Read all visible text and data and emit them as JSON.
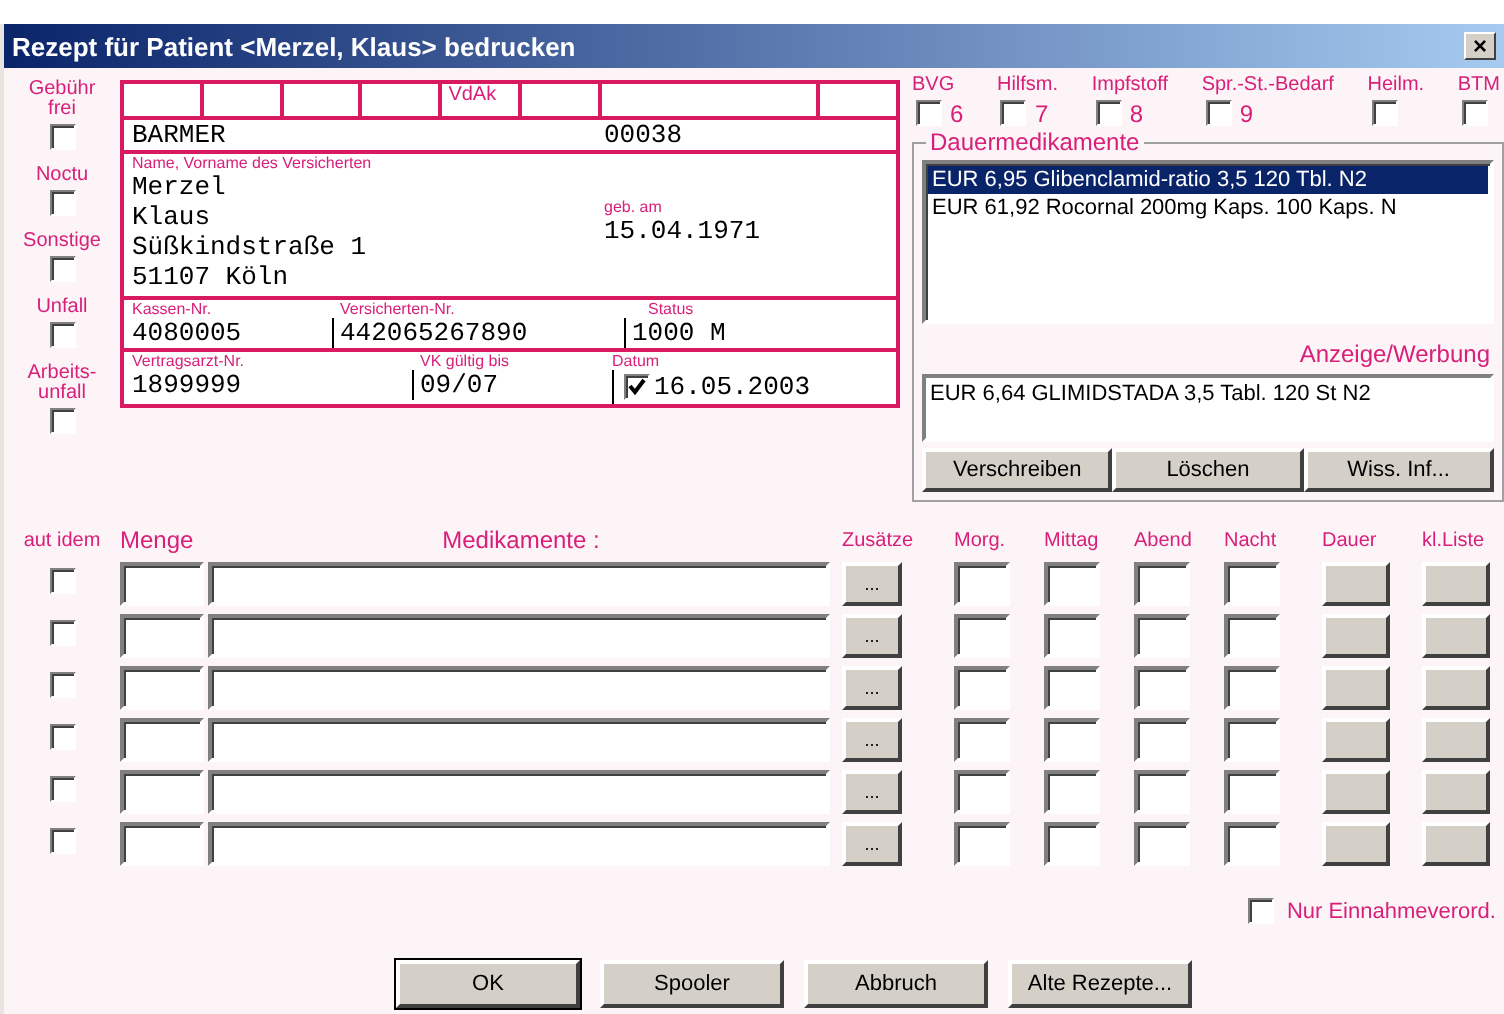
{
  "window": {
    "title": "Rezept für Patient <Merzel, Klaus> bedrucken",
    "close": "×"
  },
  "flags": [
    {
      "label": "Gebühr frei",
      "checked": false
    },
    {
      "label": "Noctu",
      "checked": false
    },
    {
      "label": "Sonstige",
      "checked": false
    },
    {
      "label": "Unfall",
      "checked": false
    },
    {
      "label": "Arbeits-unfall",
      "checked": false
    }
  ],
  "form": {
    "header_label": "VdAk",
    "insurer": "BARMER",
    "insurer_code": "00038",
    "name_label": "Name, Vorname des Versicherten",
    "address_lines": [
      "Merzel",
      "Klaus",
      "Süßkindstraße 1",
      "51107 Köln"
    ],
    "dob_label": "geb. am",
    "dob": "15.04.1971",
    "kassen_label": "Kassen-Nr.",
    "kassen": "4080005",
    "versicherten_label": "Versicherten-Nr.",
    "versicherten": "442065267890",
    "status_label": "Status",
    "status": "1000 M",
    "arzt_label": "Vertragsarzt-Nr.",
    "arzt": "1899999",
    "vk_label": "VK gültig bis",
    "vk": "09/07",
    "datum_label": "Datum",
    "datum_checked": true,
    "datum": "16.05.2003"
  },
  "categories": [
    {
      "label": "BVG",
      "number": "6",
      "checked": false
    },
    {
      "label": "Hilfsm.",
      "number": "7",
      "checked": false
    },
    {
      "label": "Impfstoff",
      "number": "8",
      "checked": false
    },
    {
      "label": "Spr.-St.-Bedarf",
      "number": "9",
      "checked": false
    },
    {
      "label": "Heilm.",
      "checked": false
    },
    {
      "label": "BTM",
      "checked": false
    }
  ],
  "dauermedikamente": {
    "title": "Dauermedikamente",
    "items": [
      {
        "text": "EUR 6,95 Glibenclamid-ratio 3,5 120 Tbl.  N2",
        "selected": true
      },
      {
        "text": "EUR 61,92 Rocornal 200mg Kaps. 100 Kaps.  N",
        "selected": false
      }
    ],
    "ad_label": "Anzeige/Werbung",
    "ad_text": "EUR 6,64  GLIMIDSTADA 3,5 Tabl. 120 St N2",
    "buttons": [
      "Verschreiben",
      "Löschen",
      "Wiss. Inf..."
    ]
  },
  "columns": {
    "aut_idem": "aut idem",
    "menge": "Menge",
    "medikamente": "Medikamente :",
    "zusaetze": "Zusätze",
    "morg": "Morg.",
    "mittag": "Mittag",
    "abend": "Abend",
    "nacht": "Nacht",
    "dauer": "Dauer",
    "kl_liste": "kl.Liste"
  },
  "rows": [
    {
      "aut_idem": false,
      "more": "..."
    },
    {
      "aut_idem": false,
      "more": "..."
    },
    {
      "aut_idem": false,
      "more": "..."
    },
    {
      "aut_idem": false,
      "more": "..."
    },
    {
      "aut_idem": false,
      "more": "..."
    },
    {
      "aut_idem": false,
      "more": "..."
    }
  ],
  "nur_einnahme": {
    "label": "Nur Einnahmeverord.",
    "checked": false
  },
  "buttons": [
    {
      "label": "OK",
      "default": true
    },
    {
      "label": "Spooler",
      "default": false
    },
    {
      "label": "Abbruch",
      "default": false
    },
    {
      "label": "Alte Rezepte...",
      "default": false
    }
  ]
}
